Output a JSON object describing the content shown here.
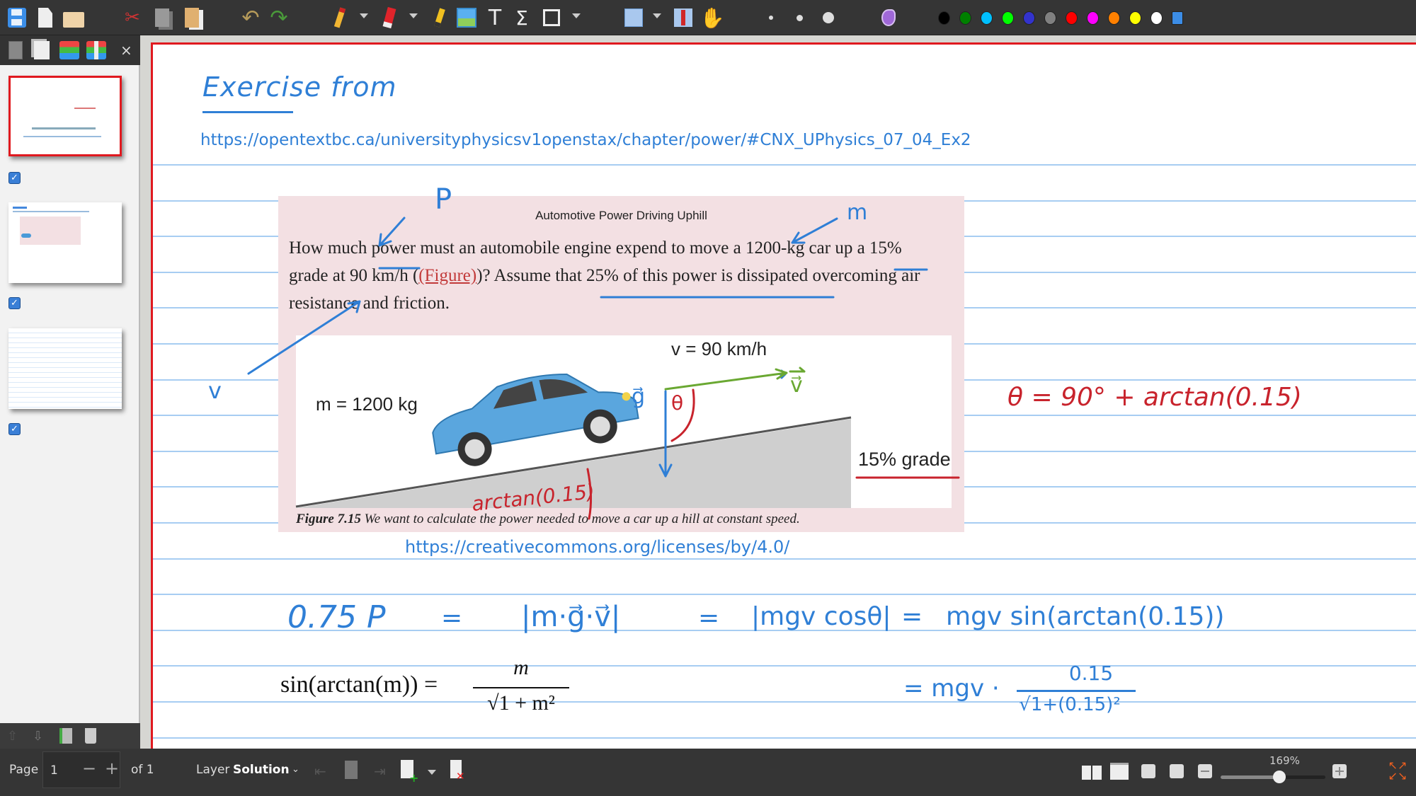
{
  "toolbar": {
    "tools": [
      "save-icon",
      "new-document-icon",
      "open-folder-icon",
      "cut-icon",
      "copy-icon",
      "paste-icon",
      "undo-icon",
      "redo-icon",
      "pen-icon",
      "eraser-icon",
      "highlighter-icon",
      "image-icon",
      "text-icon",
      "math-icon",
      "shape-icon",
      "select-rect-icon",
      "vertical-space-icon",
      "hand-icon"
    ],
    "pen_sizes": [
      "fine",
      "medium",
      "thick"
    ],
    "colors": [
      "#000000",
      "#008000",
      "#00c0ff",
      "#00ff00",
      "#3333cc",
      "#808080",
      "#ff0000",
      "#ff00ff",
      "#ff8000",
      "#ffff00",
      "#ffffff",
      "#3c8de6"
    ]
  },
  "sidebar": {
    "tabs": [
      "page-preview-icon",
      "pages-icon",
      "layers-icon",
      "layer-add-icon"
    ],
    "close_label": "×",
    "pages": [
      {
        "checked": true
      },
      {
        "checked": true
      },
      {
        "checked": true
      }
    ]
  },
  "page": {
    "heading": "Exercise from",
    "source_url": "https://opentextbc.ca/universityphysicsv1openstax/chapter/power/#CNX_UPhysics_07_04_Ex2",
    "license_url": "https://creativecommons.org/licenses/by/4.0/",
    "excerpt": {
      "title": "Automotive Power Driving Uphill",
      "line1": "How much power must an automobile engine expend to move a 1200-kg car up a 15%",
      "line2_a": "grade at 90 km/h (",
      "line2_link": "(Figure)",
      "line2_b": ")? Assume that 25% of this power is dissipated overcoming air",
      "line3": "resistance and friction.",
      "figure_v_label": "v = 90 km/h",
      "figure_m_label": "m = 1200 kg",
      "figure_grade_label": "15% grade",
      "caption_bold": "Figure 7.15",
      "caption": " We want to calculate the power needed to move a car up a hill at constant speed."
    },
    "annotations": {
      "p_label": "P",
      "m_label": "m",
      "v_label": "v",
      "g_vec": "g⃗",
      "v_vec": "v⃗",
      "theta_small": "θ",
      "arctan_label": "arctan(0.15)",
      "theta_eq": "θ = 90° + arctan(0.15)",
      "eq1": [
        "0.75 P",
        "=",
        "|m·g⃗·v⃗|",
        "=",
        "|mgv cosθ|",
        "=",
        "mgv sin(arctan(0.15))"
      ],
      "eq2_lhs": "sin(arctan(m)) =",
      "eq2_num": "m",
      "eq2_den": "√1 + m²",
      "eq3_prefix": "= mgv ·",
      "eq3_num": "0.15",
      "eq3_den": "√1+(0.15)²"
    }
  },
  "bottombar": {
    "page_label": "Page",
    "page_value": "1",
    "minus": "−",
    "plus": "+",
    "of_label": "of 1",
    "layer_label": "Layer",
    "layer_value": "Solution",
    "zoom_label": "169%",
    "zoom_percent": 169
  }
}
